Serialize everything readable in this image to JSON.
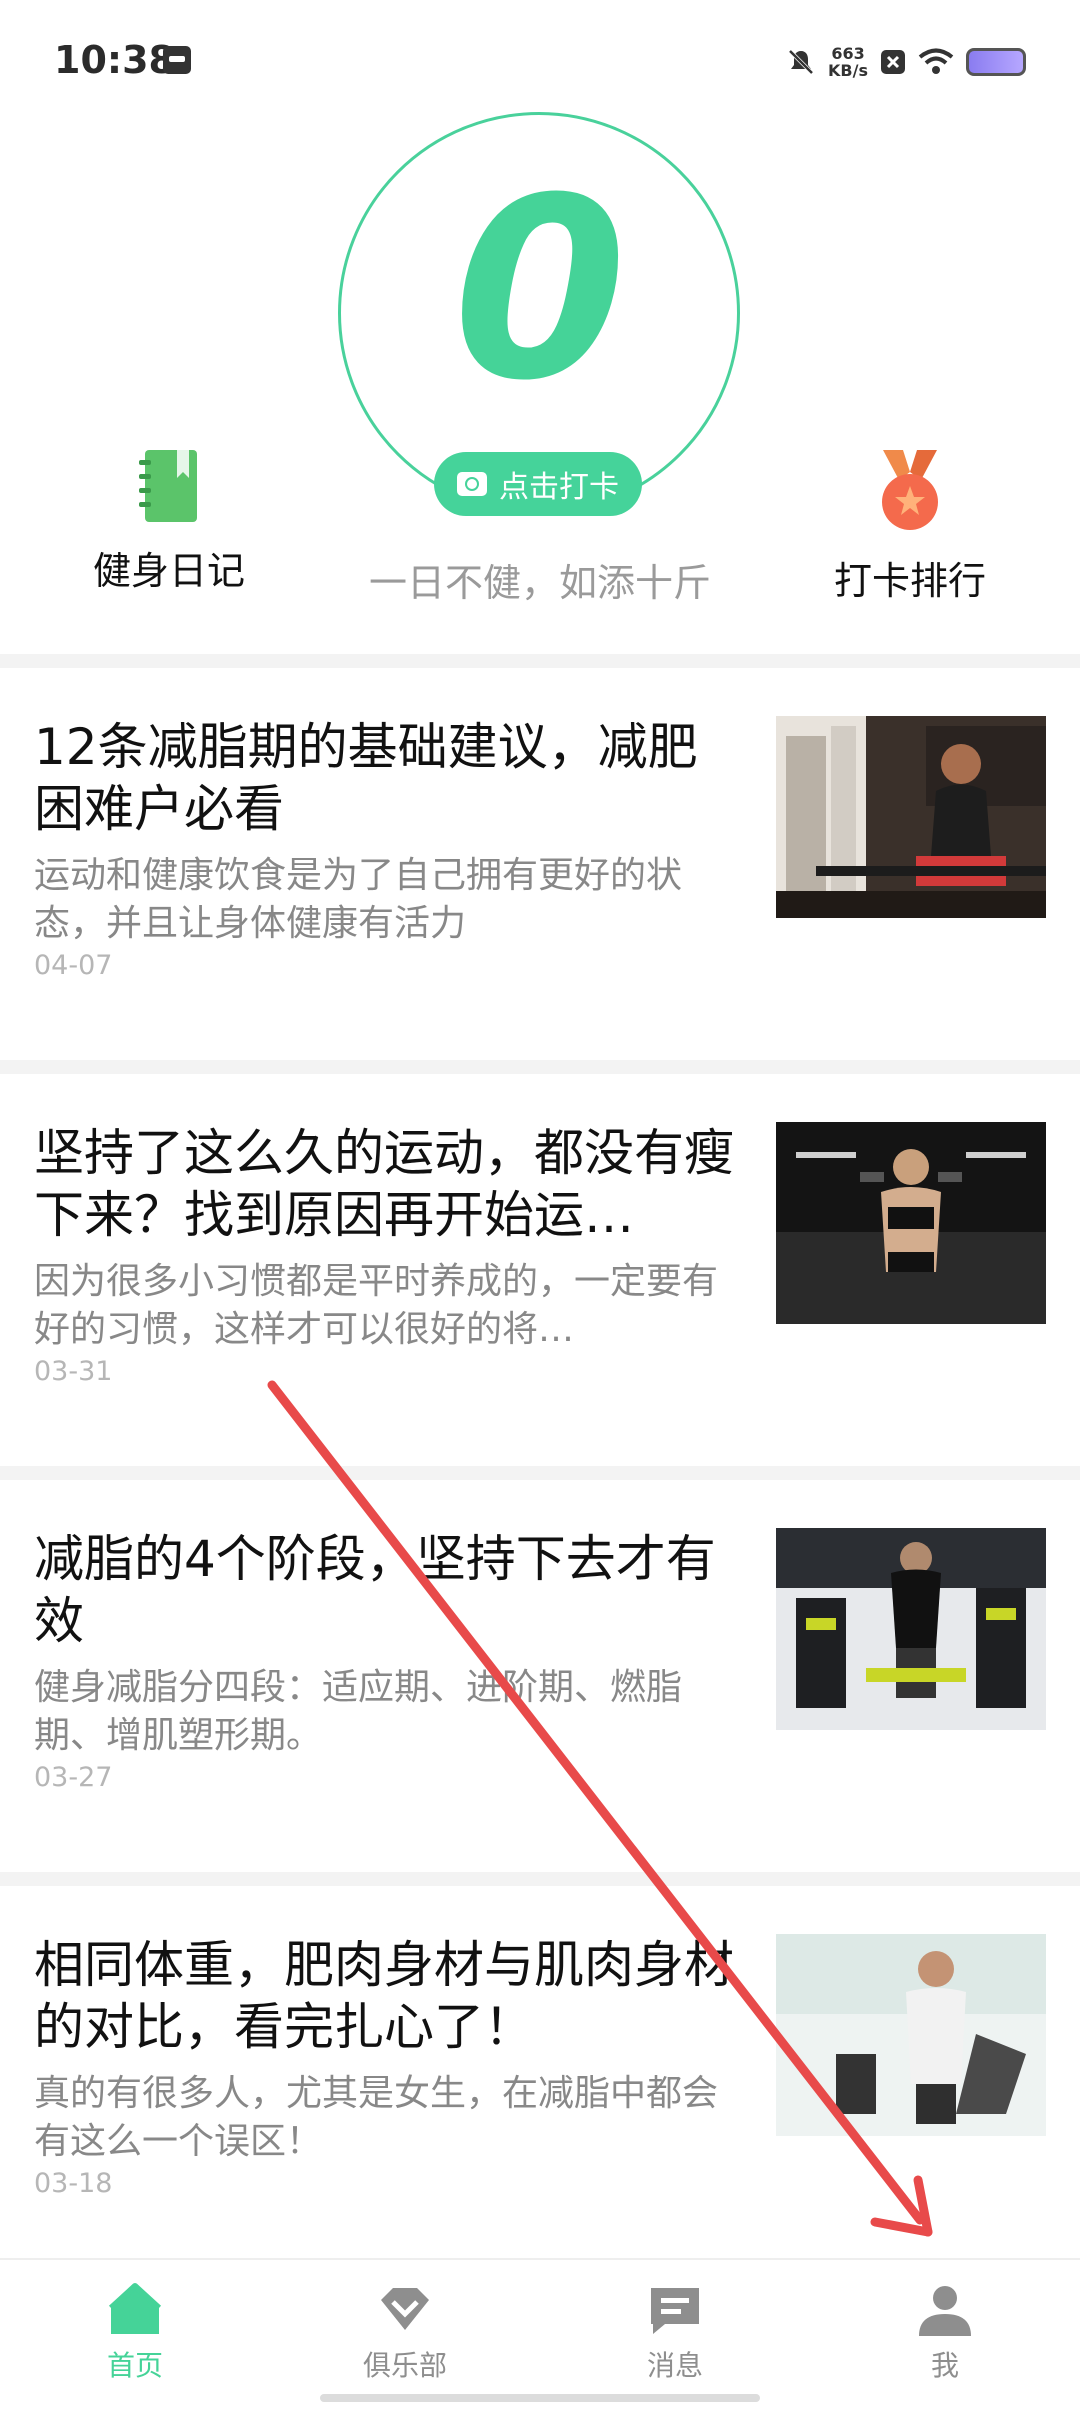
{
  "status_bar": {
    "time": "10:38",
    "speed_value": "663",
    "speed_unit": "KB/s",
    "icons": [
      "calendar-icon",
      "mute-icon",
      "close-box-icon",
      "wifi-icon",
      "battery-icon"
    ]
  },
  "header": {
    "checkin_count": "0",
    "checkin_button": "点击打卡",
    "slogan": "一日不健，如添十斤",
    "diary_label": "健身日记",
    "rank_label": "打卡排行"
  },
  "articles": [
    {
      "title": "12条减脂期的基础建议，减肥困难户必看",
      "desc": "运动和健康饮食是为了自己拥有更好的状态，并且让身体健康有活力",
      "date": "04-07"
    },
    {
      "title": "坚持了这么久的运动，都没有瘦下来？找到原因再开始运…",
      "desc": "因为很多小习惯都是平时养成的，一定要有好的习惯，这样才可以很好的将…",
      "date": "03-31"
    },
    {
      "title": "减脂的4个阶段，坚持下去才有效",
      "desc": "健身减脂分四段：适应期、进阶期、燃脂期、增肌塑形期。",
      "date": "03-27"
    },
    {
      "title": "相同体重，肥肉身材与肌肉身材的对比，看完扎心了！",
      "desc": "真的有很多人，尤其是女生，在减脂中都会有这么一个误区！",
      "date": "03-18"
    }
  ],
  "tabbar": {
    "tabs": [
      {
        "label": "首页",
        "icon": "home-icon",
        "active": true
      },
      {
        "label": "俱乐部",
        "icon": "diamond-icon",
        "active": false
      },
      {
        "label": "消息",
        "icon": "message-icon",
        "active": false
      },
      {
        "label": "我",
        "icon": "user-icon",
        "active": false
      }
    ]
  },
  "colors": {
    "accent": "#45d398",
    "annotation_arrow": "#e84a4a"
  }
}
